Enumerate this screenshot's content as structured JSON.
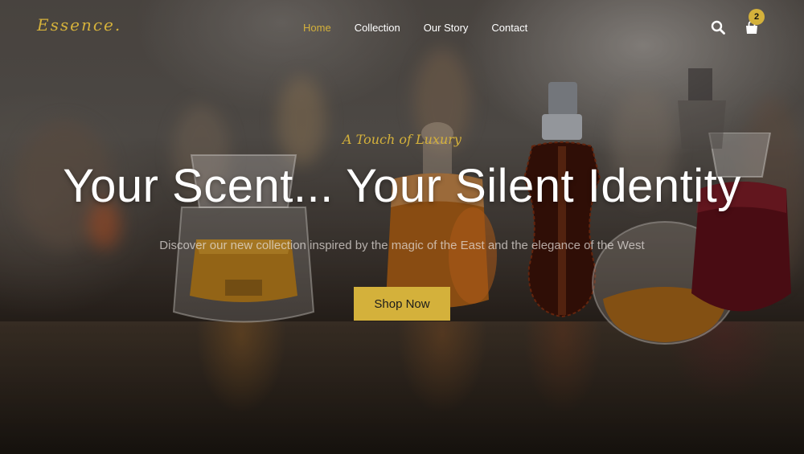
{
  "brand": {
    "logo": "Essence."
  },
  "nav": {
    "items": [
      {
        "label": "Home",
        "active": true
      },
      {
        "label": "Collection",
        "active": false
      },
      {
        "label": "Our Story",
        "active": false
      },
      {
        "label": "Contact",
        "active": false
      }
    ]
  },
  "header": {
    "search_icon": "search-icon",
    "cart_icon": "shopping-bag-icon",
    "cart_count": "2"
  },
  "hero": {
    "tagline": "A Touch of Luxury",
    "headline": "Your Scent... Your Silent Identity",
    "subtitle": "Discover our new collection inspired by the magic of the East and the elegance of the West",
    "cta_label": "Shop Now"
  },
  "colors": {
    "accent": "#d4b13b",
    "text": "#ffffff",
    "subtitle": "#c9c3bd",
    "button_text": "#1b1b1b"
  }
}
